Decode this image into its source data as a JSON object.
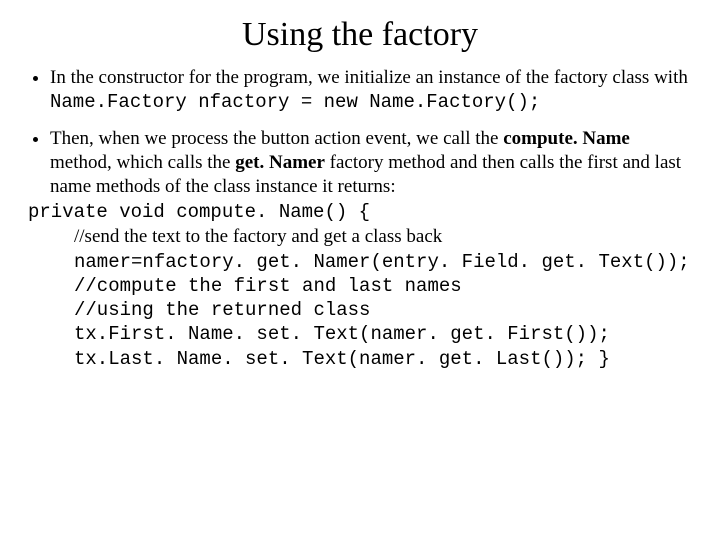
{
  "title": "Using the factory",
  "bullet1_a": "In the constructor for the program, we initialize an instance of the factory class with  ",
  "bullet1_code": "Name.Factory nfactory = new Name.Factory();",
  "bullet2_a": "Then, when we process the button action event, we call the ",
  "bullet2_b": "compute. Name",
  "bullet2_c": " method, which calls the ",
  "bullet2_d": "get. Namer",
  "bullet2_e": " factory method and then calls the first and last name methods of the class instance it returns:",
  "code1": "private void compute. Name() {",
  "comment1": "//send the text to the factory and get a class back",
  "code2": "namer=nfactory. get. Namer(entry. Field. get. Text());",
  "code3": "//compute the first and last names",
  "code4": "//using the returned class",
  "code5": "tx.First. Name. set. Text(namer. get. First());",
  "code6": "tx.Last. Name. set. Text(namer. get. Last());   }"
}
